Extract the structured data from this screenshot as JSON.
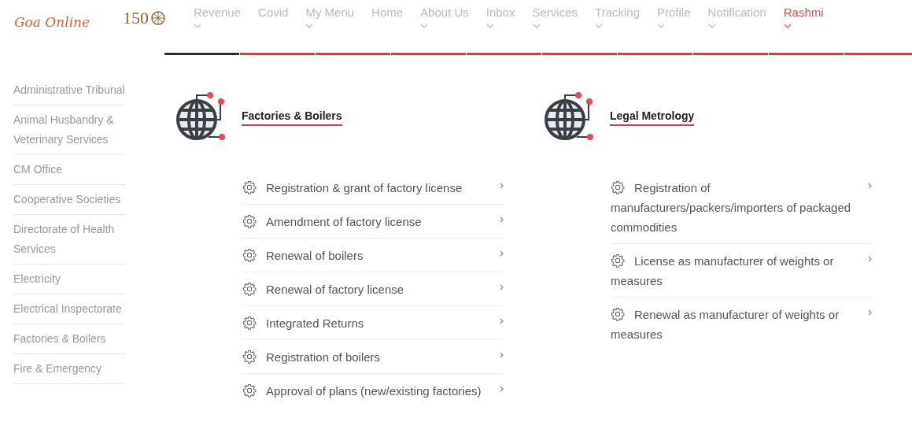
{
  "logo": {
    "text": "Goa Online",
    "badge": "150"
  },
  "nav": [
    {
      "label": "Revenue",
      "has_menu": true,
      "selected": false
    },
    {
      "label": "Covid",
      "has_menu": false,
      "selected": false
    },
    {
      "label": "My Menu",
      "has_menu": true,
      "selected": false
    },
    {
      "label": "Home",
      "has_menu": false,
      "selected": false
    },
    {
      "label": "About Us",
      "has_menu": true,
      "selected": false
    },
    {
      "label": "Inbox",
      "has_menu": true,
      "selected": false
    },
    {
      "label": "Services",
      "has_menu": true,
      "selected": false
    },
    {
      "label": "Tracking",
      "has_menu": true,
      "selected": false
    },
    {
      "label": "Profile",
      "has_menu": true,
      "selected": false
    },
    {
      "label": "Notification",
      "has_menu": true,
      "selected": false
    },
    {
      "label": "Rashmi",
      "has_menu": true,
      "selected": true
    }
  ],
  "sidebar": {
    "items": [
      "Administrative Tribunal",
      "Animal Husbandry & Veterinary Services",
      "CM Office",
      "Cooperative Societies",
      "Directorate of Health Services",
      "Electricity",
      "Electrical Inspectorate",
      "Factories & Boilers",
      "Fire & Emergency"
    ]
  },
  "departments": [
    {
      "title": "Factories & Boilers",
      "services": [
        "Registration & grant of factory license",
        "Amendment of factory license",
        "Renewal of boilers",
        "Renewal of factory license",
        "Integrated Returns",
        "Registration of boilers",
        "Approval of plans (new/existing factories)"
      ]
    },
    {
      "title": "Legal Metrology",
      "services": [
        "Registration of manufacturers/packers/importers of packaged commodities",
        "License as manufacturer of weights or measures",
        "Renewal as manufacturer of weights or measures"
      ]
    }
  ]
}
